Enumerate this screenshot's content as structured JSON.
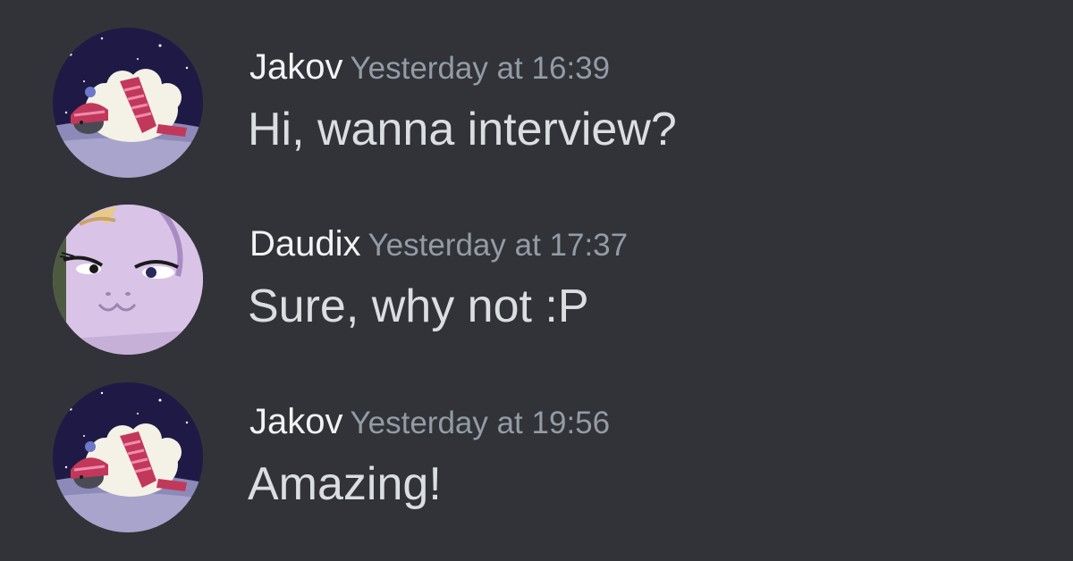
{
  "theme": {
    "background": "#313338",
    "username_color": "#f2f3f5",
    "timestamp_color": "#949ba4",
    "text_color": "#dbdee1"
  },
  "messages": [
    {
      "author": "Jakov",
      "timestamp": "Yesterday at 16:39",
      "text": "Hi, wanna interview?",
      "avatar": "sheep-with-pink-hat-avatar"
    },
    {
      "author": "Daudix",
      "timestamp": "Yesterday at 17:37",
      "text": "Sure, why not :P",
      "avatar": "purple-pony-face-avatar"
    },
    {
      "author": "Jakov",
      "timestamp": "Yesterday at 19:56",
      "text": "Amazing!",
      "avatar": "sheep-with-pink-hat-avatar"
    }
  ]
}
